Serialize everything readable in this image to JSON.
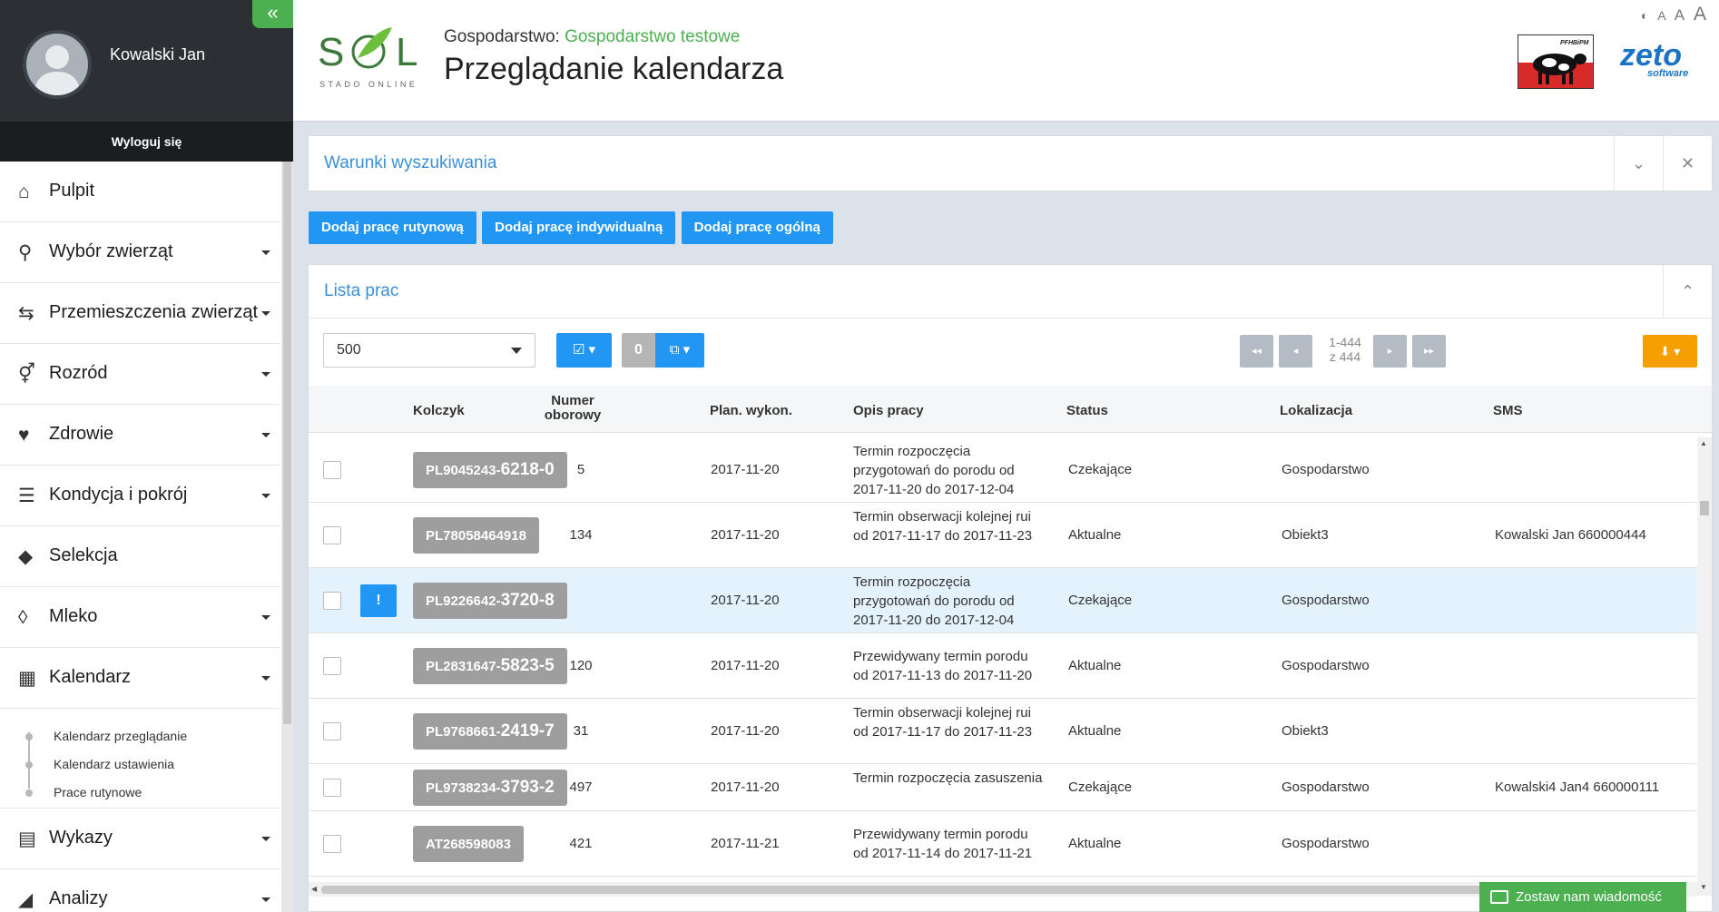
{
  "sidebar": {
    "user_name": "Kowalski Jan",
    "logout_label": "Wyloguj się",
    "collapse_icon": "«",
    "items": [
      {
        "label": "Pulpit",
        "icon": "home-icon",
        "has_caret": false
      },
      {
        "label": "Wybór zwierząt",
        "icon": "search-icon",
        "has_caret": true
      },
      {
        "label": "Przemieszczenia zwierząt",
        "icon": "signpost-icon",
        "has_caret": true
      },
      {
        "label": "Rozród",
        "icon": "gender-icon",
        "has_caret": true
      },
      {
        "label": "Zdrowie",
        "icon": "heartbeat-icon",
        "has_caret": true
      },
      {
        "label": "Kondycja i pokrój",
        "icon": "list-icon",
        "has_caret": true
      },
      {
        "label": "Selekcja",
        "icon": "tags-icon",
        "has_caret": false
      },
      {
        "label": "Mleko",
        "icon": "drop-icon",
        "has_caret": true
      },
      {
        "label": "Kalendarz",
        "icon": "calendar-icon",
        "has_caret": true
      }
    ],
    "submenu": [
      "Kalendarz przeglądanie",
      "Kalendarz ustawienia",
      "Prace rutynowe"
    ],
    "items_after": [
      {
        "label": "Wykazy",
        "icon": "report-list-icon",
        "has_caret": true
      },
      {
        "label": "Analizy",
        "icon": "area-chart-icon",
        "has_caret": true
      }
    ]
  },
  "header": {
    "logo_text": "STADO ONLINE",
    "farm_label": "Gospodarstwo:",
    "farm_name": "Gospodarstwo testowe",
    "title": "Przeglądanie kalendarza",
    "font_tools": [
      "A",
      "A",
      "A"
    ],
    "partner_logo_text": "PFHBiPM",
    "zeto_text": "zeto",
    "zeto_sub": "software"
  },
  "search_panel": {
    "title": "Warunki wyszukiwania"
  },
  "actions": [
    "Dodaj pracę rutynową",
    "Dodaj pracę indywidualną",
    "Dodaj pracę ogólną"
  ],
  "list_panel": {
    "title": "Lista prac",
    "page_size": "500",
    "selected_count": "0",
    "range": "1-444",
    "range_total": "z 444"
  },
  "table": {
    "columns": [
      "Kolczyk",
      "Numer oborowy",
      "Plan. wykon.",
      "Opis pracy",
      "Status",
      "Lokalizacja",
      "SMS"
    ],
    "rows": [
      {
        "tag_pre": "PL9045243-",
        "tag_big": "6218-0",
        "num": "5",
        "date": "2017-11-20",
        "desc": "Termin rozpoczęcia przygotowań do porodu od 2017-11-20 do 2017-12-04",
        "status": "Czekające",
        "loc": "Gospodarstwo",
        "sms": "",
        "warn": false,
        "highlight": false
      },
      {
        "tag_pre": "PL78058464918",
        "tag_big": "",
        "num": "134",
        "date": "2017-11-20",
        "desc": "Termin obserwacji kolejnej rui od 2017-11-17 do 2017-11-23",
        "status": "Aktualne",
        "loc": "Obiekt3",
        "sms": "Kowalski Jan 660000444",
        "warn": false,
        "highlight": false
      },
      {
        "tag_pre": "PL9226642-",
        "tag_big": "3720-8",
        "num": "",
        "date": "2017-11-20",
        "desc": "Termin rozpoczęcia przygotowań do porodu od 2017-11-20 do 2017-12-04",
        "status": "Czekające",
        "loc": "Gospodarstwo",
        "sms": "",
        "warn": true,
        "highlight": true
      },
      {
        "tag_pre": "PL2831647-",
        "tag_big": "5823-5",
        "num": "120",
        "date": "2017-11-20",
        "desc": "Przewidywany termin porodu od 2017-11-13 do 2017-11-20",
        "status": "Aktualne",
        "loc": "Gospodarstwo",
        "sms": "",
        "warn": false,
        "highlight": false
      },
      {
        "tag_pre": "PL9768661-",
        "tag_big": "2419-7",
        "num": "31",
        "date": "2017-11-20",
        "desc": "Termin obserwacji kolejnej rui od 2017-11-17 do 2017-11-23",
        "status": "Aktualne",
        "loc": "Obiekt3",
        "sms": "",
        "warn": false,
        "highlight": false
      },
      {
        "tag_pre": "PL9738234-",
        "tag_big": "3793-2",
        "num": "497",
        "date": "2017-11-20",
        "desc": "Termin rozpoczęcia zasuszenia",
        "status": "Czekające",
        "loc": "Gospodarstwo",
        "sms": "Kowalski4 Jan4 660000111",
        "warn": false,
        "highlight": false
      },
      {
        "tag_pre": "AT268598083",
        "tag_big": "",
        "num": "421",
        "date": "2017-11-21",
        "desc": "Przewidywany termin porodu od 2017-11-14 do 2017-11-21",
        "status": "Aktualne",
        "loc": "Gospodarstwo",
        "sms": "",
        "warn": false,
        "highlight": false
      }
    ]
  },
  "feedback_label": "Zostaw nam wiadomość",
  "colors": {
    "accent": "#2196f3",
    "green": "#4caf50",
    "orange": "#f5a000",
    "tag": "#9e9e9e",
    "sidebar_dark": "#2c3035"
  }
}
